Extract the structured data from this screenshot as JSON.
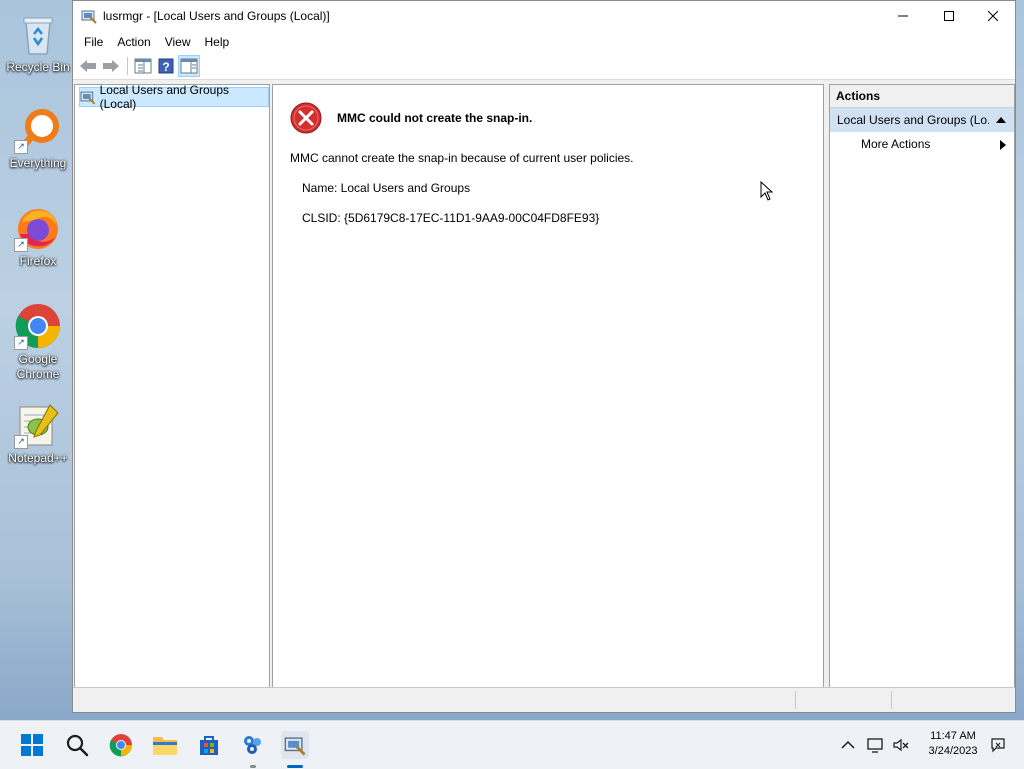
{
  "desktop": {
    "icons": [
      {
        "label": "Recycle Bin"
      },
      {
        "label": "Everything"
      },
      {
        "label": "Firefox"
      },
      {
        "label": "Google Chrome"
      },
      {
        "label": "Notepad++"
      }
    ]
  },
  "window": {
    "title": "lusrmgr - [Local Users and Groups (Local)]",
    "menu": [
      "File",
      "Action",
      "View",
      "Help"
    ]
  },
  "tree": {
    "root_label": "Local Users and Groups (Local)"
  },
  "error": {
    "title": "MMC could not create the snap-in.",
    "message": "MMC cannot create the snap-in because of current user policies.",
    "name_line": "Name: Local Users and Groups",
    "clsid_line": "CLSID: {5D6179C8-17EC-11D1-9AA9-00C04FD8FE93}"
  },
  "actions": {
    "header": "Actions",
    "group_label": "Local Users and Groups (Lo...",
    "more_actions": "More Actions"
  },
  "taskbar": {
    "time": "11:47 AM",
    "date": "3/24/2023"
  },
  "colors": {
    "accent": "#0067c0",
    "error_red": "#d32f2f",
    "selection": "#cce8ff"
  }
}
